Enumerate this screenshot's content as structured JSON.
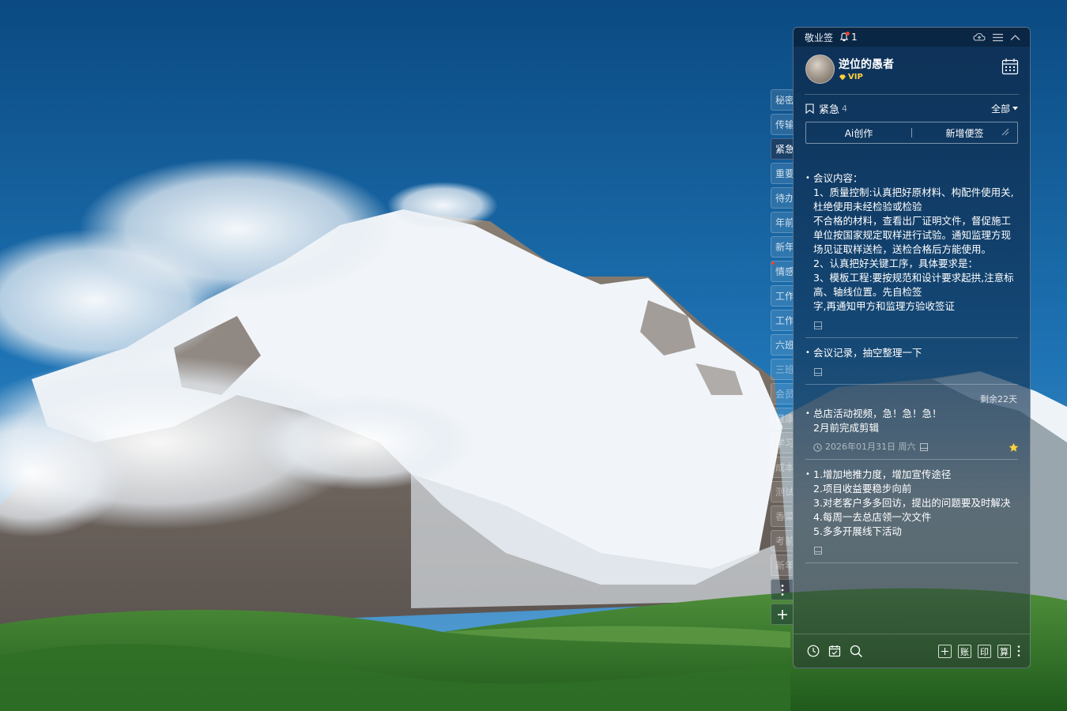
{
  "app": {
    "title": "敬业签",
    "notification_count": "1"
  },
  "profile": {
    "username": "逆位的愚者",
    "badge": "VIP"
  },
  "side_tabs": [
    "秘密",
    "传输",
    "紧急",
    "重要",
    "待办",
    "年前",
    "新年",
    "情感",
    "工作",
    "工作",
    "六班",
    "三班",
    "会员",
    "健康",
    "学习",
    "成本",
    "测试",
    "香菜",
    "考前",
    "新年"
  ],
  "side_tabs_active_index": 2,
  "side_tabs_red_dot_index": 7,
  "category": {
    "name": "紧急",
    "count": "4",
    "filter_label": "全部"
  },
  "actions": {
    "ai_label": "Ai创作",
    "new_label": "新增便签"
  },
  "notes": [
    {
      "lines": [
        "会议内容：",
        "1、质量控制:认真把好原材料、构配件使用关,杜绝使用未经检验或检验",
        "不合格的材料，查看出厂证明文件，督促施工单位按国家规定取样进行试验。通知监理方现场见证取样送检，送检合格后方能使用。",
        "2、认真把好关键工序，具体要求是：",
        "3、模板工程:要按规范和设计要求起拱,注意标高、轴线位置。先自检签",
        "字,再通知甲方和监理方验收签证"
      ]
    },
    {
      "lines": [
        "会议记录，抽空整理一下"
      ]
    },
    {
      "remaining": "剩余22天",
      "lines": [
        "总店活动视频，急！急！急！",
        "2月前完成剪辑"
      ],
      "date": "2026年01月31日 周六"
    },
    {
      "lines": [
        "1.增加地推力度，增加宣传途径",
        "2.项目收益要稳步向前",
        "3.对老客户多多回访，提出的问题要及时解决",
        "4.每周一去总店领一次文件",
        "5.多多开展线下活动"
      ]
    }
  ],
  "bottom_bar": {
    "account_label": "账",
    "print_label": "印",
    "calc_label": "算"
  },
  "colors": {
    "accent_red": "#e8402d",
    "vip_gold": "#ffd23a",
    "panel_bg": "#0e2d50"
  }
}
